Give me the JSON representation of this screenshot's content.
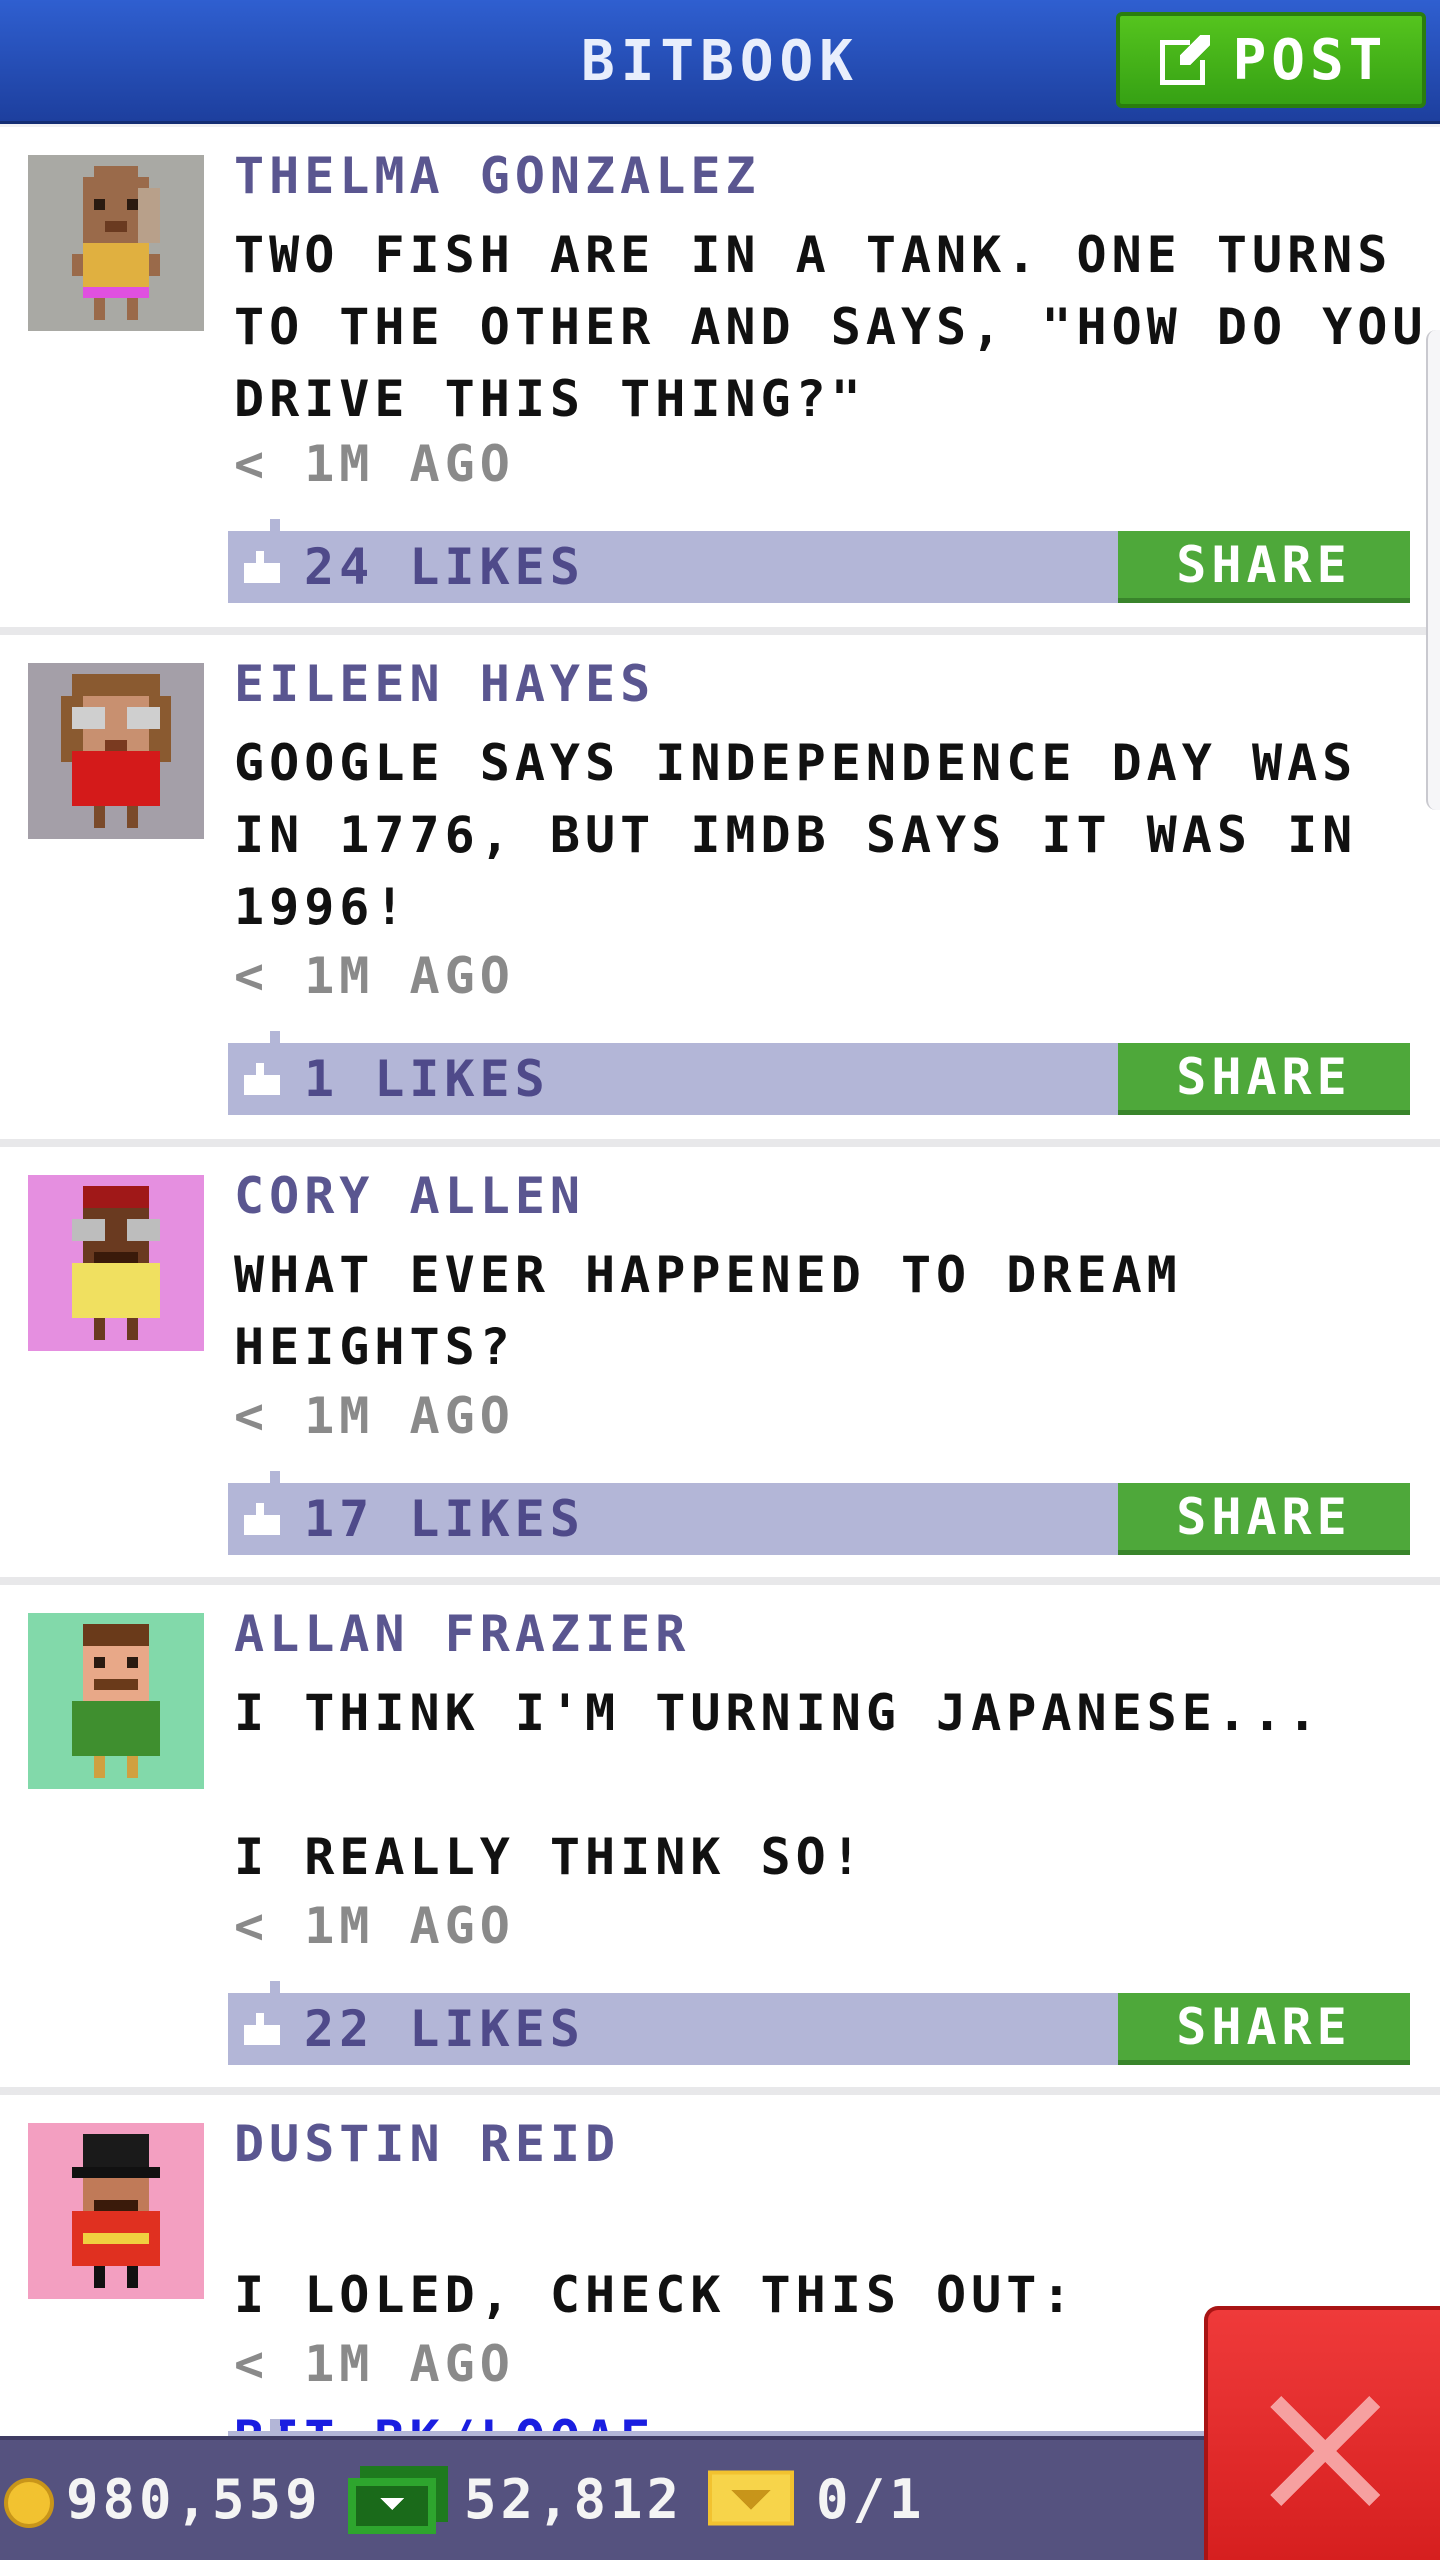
{
  "header": {
    "title": "BITBOOK",
    "post_label": "POST"
  },
  "posts": [
    {
      "author": "THELMA GONZALEZ",
      "text": "TWO FISH ARE IN A TANK. ONE TURNS TO THE OTHER AND SAYS, \"HOW DO YOU DRIVE THIS THING?\"",
      "time": "< 1M AGO",
      "likes": "24 LIKES",
      "share": "SHARE",
      "avatar_bg": "#a9a9a4"
    },
    {
      "author": "EILEEN HAYES",
      "text": "GOOGLE SAYS INDEPENDENCE DAY WAS IN 1776, BUT IMDB SAYS IT WAS IN 1996!",
      "time": "< 1M AGO",
      "likes": "1 LIKES",
      "share": "SHARE",
      "avatar_bg": "#a49fa8"
    },
    {
      "author": "CORY ALLEN",
      "text": "WHAT EVER HAPPENED TO DREAM HEIGHTS?",
      "time": "< 1M AGO",
      "likes": "17 LIKES",
      "share": "SHARE",
      "avatar_bg": "#e58fe0"
    },
    {
      "author": "ALLAN FRAZIER",
      "text": "I THINK I'M TURNING JAPANESE...\n\nI REALLY THINK SO!",
      "time": "< 1M AGO",
      "likes": "22 LIKES",
      "share": "SHARE",
      "avatar_bg": "#82d9aa"
    },
    {
      "author": "DUSTIN REID",
      "text": "I LOLED, CHECK THIS OUT:",
      "link": "BIT.BK/LQOAE",
      "time": "< 1M AGO",
      "avatar_bg": "#f39fc1"
    }
  ],
  "bottom_bar": {
    "coins": "980,559",
    "bux": "52,812",
    "tickets": "0/1"
  },
  "colors": {
    "header": "#2650c0",
    "post_button": "#46b318",
    "like_bar": "#b3b6d7",
    "share_button": "#4ea83a",
    "close_button": "#e02a2a",
    "link": "#1a1ee0"
  }
}
